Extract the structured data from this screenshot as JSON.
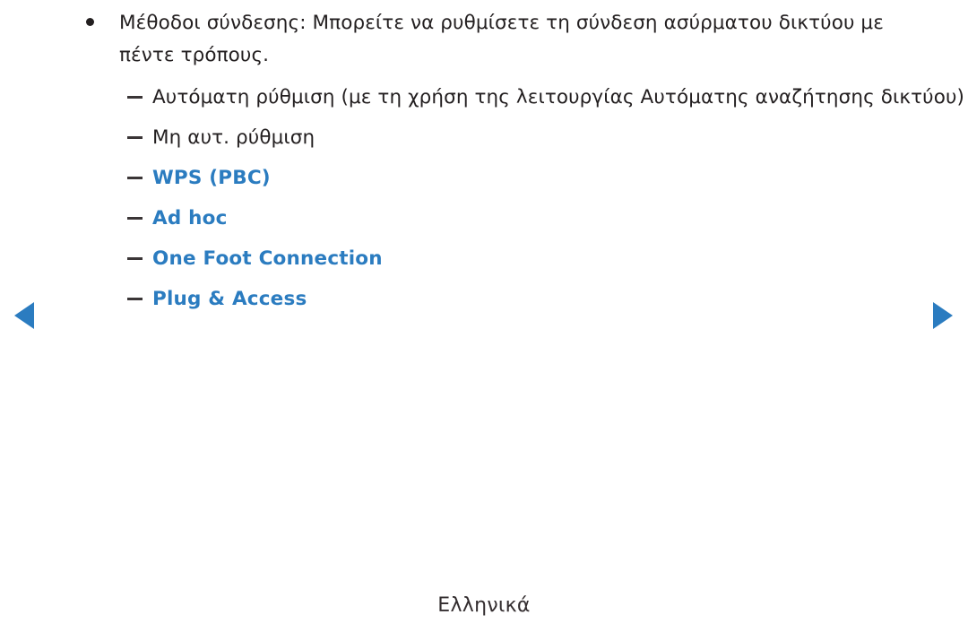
{
  "page": {
    "language_footer": "Ελληνικά",
    "background_color": "#ffffff",
    "text_color": "#231f20",
    "link_color": "#2b7cc0",
    "arrow_color": "#2b7cc0"
  },
  "content": {
    "bullet": {
      "marker": "bullet-dot",
      "text": "Μέθοδοι σύνδεσης: Μπορείτε να ρυθμίσετε τη σύνδεση ασύρματου δικτύου με πέντε τρόπους."
    },
    "sub_items": [
      {
        "marker": "dash",
        "label": "Αυτόματη ρύθμιση (με τη χρήση της λειτουργίας Αυτόματης αναζήτησης δικτύου)",
        "is_link": false
      },
      {
        "marker": "dash",
        "label": "Μη αυτ. ρύθμιση",
        "is_link": false
      },
      {
        "marker": "dash",
        "label": "WPS (PBC)",
        "is_link": true
      },
      {
        "marker": "dash",
        "label": "Ad hoc",
        "is_link": true
      },
      {
        "marker": "dash",
        "label": "One Foot Connection",
        "is_link": true
      },
      {
        "marker": "dash",
        "label": "Plug & Access",
        "is_link": true
      }
    ]
  },
  "navigation": {
    "previous": {
      "icon": "triangle-left-icon",
      "label": ""
    },
    "next": {
      "icon": "triangle-right-icon",
      "label": ""
    }
  }
}
